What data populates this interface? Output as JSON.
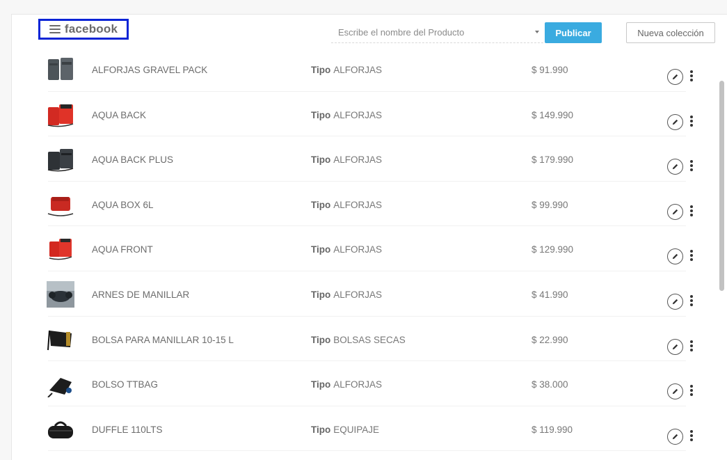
{
  "header": {
    "brand": "facebook",
    "search_placeholder": "Escribe el nombre del Producto",
    "publish_label": "Publicar",
    "new_collection_label": "Nueva colección"
  },
  "type_label": "Tipo",
  "products": [
    {
      "name": "ALFORJAS GRAVEL PACK",
      "type": "ALFORJAS",
      "price": "$ 91.990",
      "thumb": "gray-panniers"
    },
    {
      "name": "AQUA BACK",
      "type": "ALFORJAS",
      "price": "$ 149.990",
      "thumb": "red-panniers"
    },
    {
      "name": "AQUA BACK PLUS",
      "type": "ALFORJAS",
      "price": "$ 179.990",
      "thumb": "dark-panniers"
    },
    {
      "name": "AQUA BOX 6L",
      "type": "ALFORJAS",
      "price": "$ 99.990",
      "thumb": "red-box"
    },
    {
      "name": "AQUA FRONT",
      "type": "ALFORJAS",
      "price": "$ 129.990",
      "thumb": "red-front"
    },
    {
      "name": "ARNES DE MANILLAR",
      "type": "ALFORJAS",
      "price": "$ 41.990",
      "thumb": "harness-photo"
    },
    {
      "name": "BOLSA PARA MANILLAR 10-15 L",
      "type": "BOLSAS SECAS",
      "price": "$ 22.990",
      "thumb": "black-drybag"
    },
    {
      "name": "BOLSO TTBAG",
      "type": "ALFORJAS",
      "price": "$ 38.000",
      "thumb": "top-tube-bag"
    },
    {
      "name": "DUFFLE 110LTS",
      "type": "EQUIPAJE",
      "price": "$ 119.990",
      "thumb": "duffle-bag"
    }
  ],
  "icons": {
    "menu": "hamburger-icon",
    "dropdown": "caret-down-icon",
    "edit": "pencil-icon",
    "more": "kebab-icon"
  },
  "colors": {
    "primary_button": "#3aabe0",
    "brand_highlight_border": "#0a24d6"
  }
}
